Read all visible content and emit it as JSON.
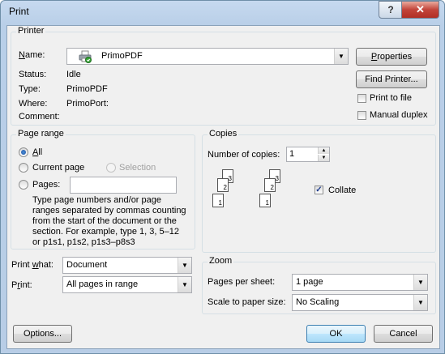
{
  "title": "Print",
  "titlebar": {
    "help": "?",
    "close": "✕"
  },
  "printer": {
    "group_label": "Printer",
    "name_label": "Name:",
    "name_value": "PrimoPDF",
    "status_label": "Status:",
    "status_value": "Idle",
    "type_label": "Type:",
    "type_value": "PrimoPDF",
    "where_label": "Where:",
    "where_value": "PrimoPort:",
    "comment_label": "Comment:",
    "comment_value": "",
    "properties_button": "Properties",
    "find_printer_button": "Find Printer...",
    "print_to_file_label": "Print to file",
    "print_to_file_checked": false,
    "manual_duplex_label": "Manual duplex",
    "manual_duplex_checked": false
  },
  "page_range": {
    "group_label": "Page range",
    "all_label": "All",
    "current_page_label": "Current page",
    "selection_label": "Selection",
    "pages_label": "Pages:",
    "pages_value": "",
    "selected": "All",
    "hint": "Type page numbers and/or page ranges separated by commas counting from the start of the document or the section. For example, type 1, 3, 5–12 or p1s1, p1s2, p1s3–p8s3"
  },
  "copies": {
    "group_label": "Copies",
    "number_label": "Number of copies:",
    "number_value": "1",
    "collate_label": "Collate",
    "collate_checked": true,
    "page_labels": [
      "1",
      "2",
      "3"
    ]
  },
  "print_what": {
    "label": "Print what:",
    "value": "Document"
  },
  "print": {
    "label": "Print:",
    "value": "All pages in range"
  },
  "zoom": {
    "group_label": "Zoom",
    "pages_per_sheet_label": "Pages per sheet:",
    "pages_per_sheet_value": "1 page",
    "scale_label": "Scale to paper size:",
    "scale_value": "No Scaling"
  },
  "footer": {
    "options": "Options...",
    "ok": "OK",
    "cancel": "Cancel"
  }
}
